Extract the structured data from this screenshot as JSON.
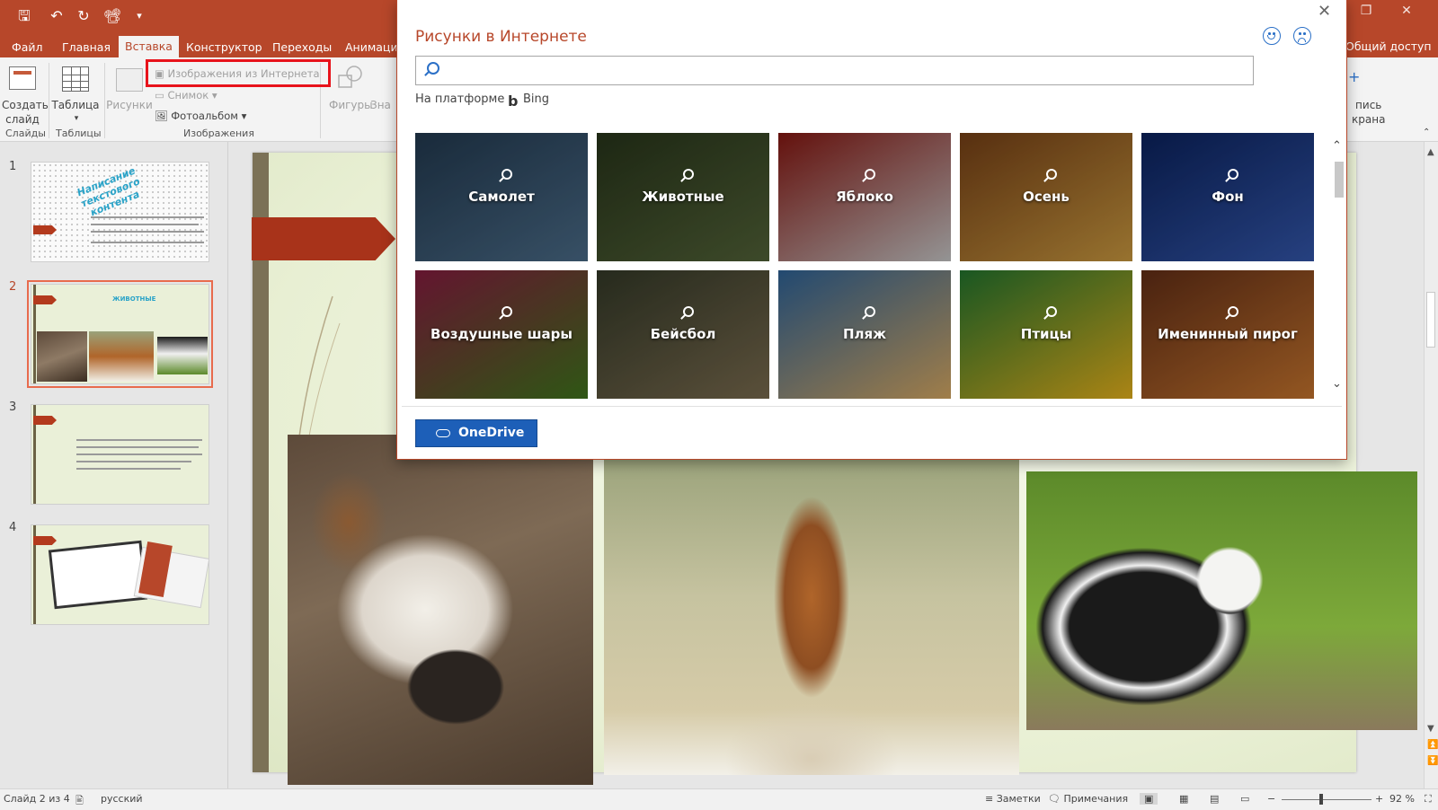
{
  "tabs": [
    "Файл",
    "Главная",
    "Вставка",
    "Конструктор",
    "Переходы",
    "Анимаци"
  ],
  "share_label": "Общий доступ",
  "ribbon": {
    "new_slide": [
      "Создать",
      "слайд"
    ],
    "table": "Таблица",
    "pictures": "Рисунки",
    "online_images": "Изображения из Интернета",
    "screenshot": "Снимок",
    "photo_album": "Фотоальбом",
    "shapes": "Фигуры",
    "zna": "Зна",
    "right_cut": [
      "пись",
      "крана"
    ],
    "group_slides": "Слайды",
    "group_tables": "Таблицы",
    "group_images": "Изображения"
  },
  "slides": [
    {
      "num": "1",
      "title": "Написание текстового контента"
    },
    {
      "num": "2",
      "title": "ЖИВОТНЫЕ"
    },
    {
      "num": "3"
    },
    {
      "num": "4"
    }
  ],
  "dialog": {
    "title": "Рисунки в Интернете",
    "search_placeholder": "",
    "platform_label": "На платформе",
    "bing_label": "Bing",
    "onedrive_label": "OneDrive",
    "tiles": [
      {
        "label": "Самолет",
        "colors": [
          "#1f3448",
          "#44627c"
        ]
      },
      {
        "label": "Животные",
        "colors": [
          "#243018",
          "#4b5a33"
        ]
      },
      {
        "label": "Яблоко",
        "colors": [
          "#7a1510",
          "#b5b5b5"
        ]
      },
      {
        "label": "Осень",
        "colors": [
          "#6b3a14",
          "#b98c3a"
        ]
      },
      {
        "label": "Фон",
        "colors": [
          "#0a1f55",
          "#2f4f9c"
        ]
      },
      {
        "label": "Воздушные шары",
        "colors": [
          "#7a1a3a",
          "#3a6a1a"
        ]
      },
      {
        "label": "Бейсбол",
        "colors": [
          "#2f3424",
          "#6f6248"
        ]
      },
      {
        "label": "Пляж",
        "colors": [
          "#2a5a8a",
          "#c49a5a"
        ]
      },
      {
        "label": "Птицы",
        "colors": [
          "#1f6a2a",
          "#d1a21a"
        ]
      },
      {
        "label": "Именинный пирог",
        "colors": [
          "#5a2a14",
          "#b46a2a"
        ]
      }
    ]
  },
  "status": {
    "slide_info": "Слайд 2 из 4",
    "language": "русский",
    "notes": "Заметки",
    "comments": "Примечания",
    "zoom": "92 %"
  },
  "colors": {
    "accent": "#b7472a",
    "highlight": "#e8131b",
    "link": "#2b70c7"
  }
}
